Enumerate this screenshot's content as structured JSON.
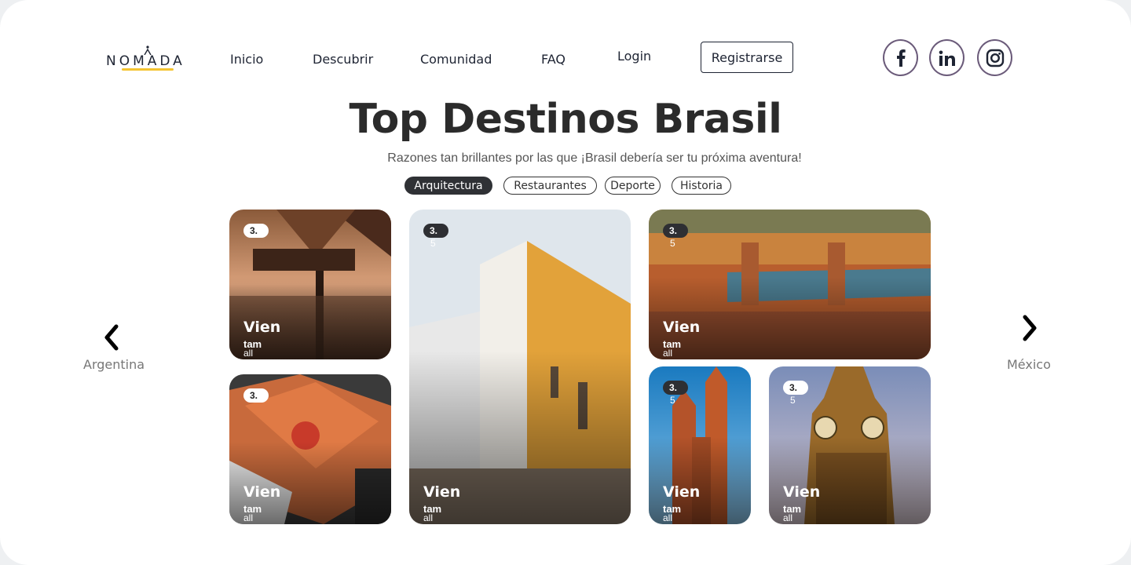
{
  "brand": {
    "name": "NOMADA"
  },
  "nav": {
    "inicio": "Inicio",
    "descubrir": "Descubrir",
    "comunidad": "Comunidad",
    "faq": "FAQ",
    "login": "Login",
    "register": "Registrarse"
  },
  "social": {
    "facebook": "facebook-icon",
    "linkedin": "linkedin-icon",
    "instagram": "instagram-icon"
  },
  "hero": {
    "title": "Top Destinos Brasil",
    "subtitle": "Razones tan brillantes por las que ¡Brasil debería ser tu próxima aventura!"
  },
  "filters": {
    "arquitectura": "Arquitectura",
    "restaurantes": "Restaurantes",
    "deporte": "Deporte",
    "historia": "Historia",
    "active": "Arquitectura"
  },
  "carousel": {
    "prev_label": "Argentina",
    "next_label": "México"
  },
  "cards": [
    {
      "rating": "3.",
      "rating_sub": "",
      "title": "Vien",
      "meta": "tam",
      "meta2": "all"
    },
    {
      "rating": "3.",
      "rating_sub": "",
      "title": "Vien",
      "meta": "tam",
      "meta2": "all"
    },
    {
      "rating": "3.",
      "rating_sub": "5",
      "title": "Vien",
      "meta": "tam",
      "meta2": "all"
    },
    {
      "rating": "3.",
      "rating_sub": "5",
      "title": "Vien",
      "meta": "tam",
      "meta2": "all"
    },
    {
      "rating": "3.",
      "rating_sub": "5",
      "title": "Vien",
      "meta": "tam",
      "meta2": "all"
    },
    {
      "rating": "3.",
      "rating_sub": "5",
      "title": "Vien",
      "meta": "tam",
      "meta2": "all"
    }
  ],
  "colors": {
    "accent": "#f4c430",
    "dark": "#2f3135",
    "social_ring": "#6b5b7a"
  }
}
